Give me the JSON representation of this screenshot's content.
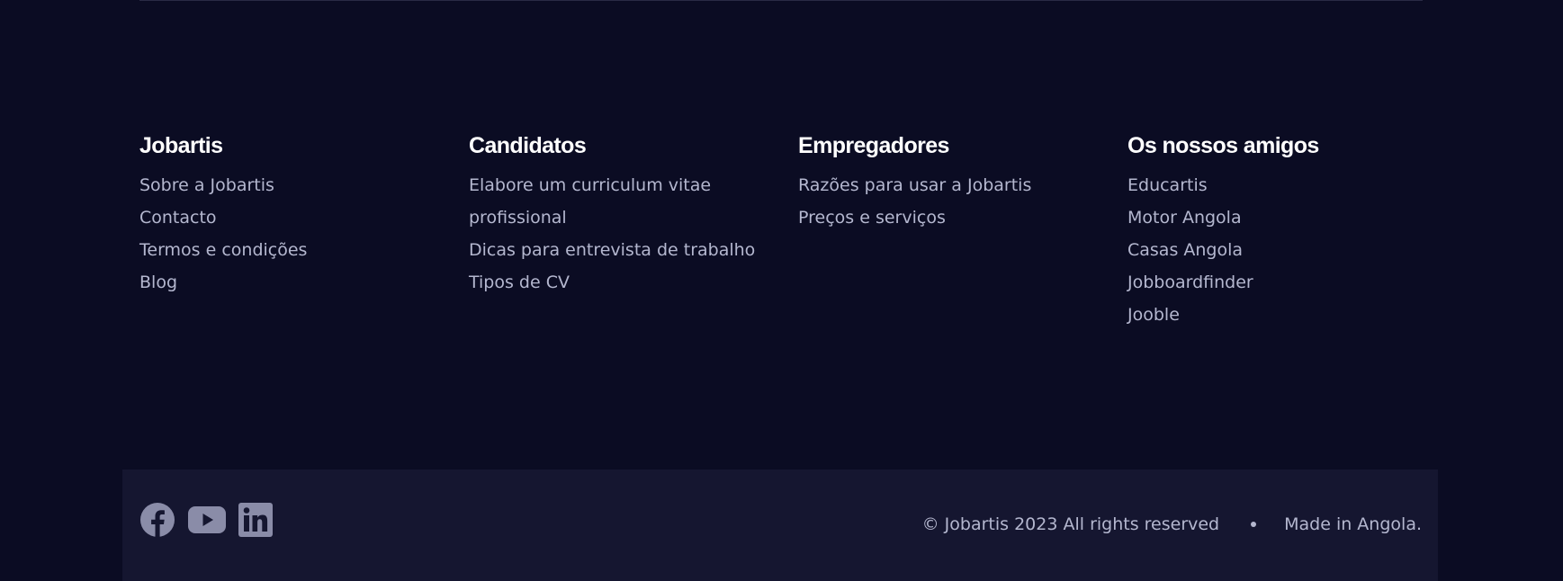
{
  "footer": {
    "columns": [
      {
        "title": "Jobartis",
        "links": [
          "Sobre a Jobartis",
          "Contacto",
          "Termos e condições",
          "Blog"
        ]
      },
      {
        "title": "Candidatos",
        "links": [
          "Elabore um curriculum vitae profissional",
          "Dicas para entrevista de trabalho",
          "Tipos de CV"
        ]
      },
      {
        "title": "Empregadores",
        "links": [
          "Razões para usar a Jobartis",
          "Preços e serviços"
        ]
      },
      {
        "title": "Os nossos amigos",
        "links": [
          "Educartis",
          "Motor Angola",
          "Casas Angola",
          "Jobboardfinder",
          "Jooble"
        ]
      }
    ]
  },
  "bottom": {
    "social_icons": [
      "facebook-icon",
      "youtube-icon",
      "linkedin-icon"
    ],
    "copyright": "© Jobartis 2023 All rights reserved",
    "made_in": "Made in Angola."
  },
  "colors": {
    "background": "#0b0c23",
    "bottom_bar": "#151630",
    "heading": "#ffffff",
    "link": "#b4b7cf",
    "icon": "#8a8ca8"
  }
}
